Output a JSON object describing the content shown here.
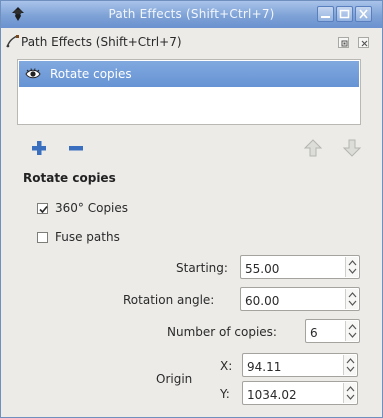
{
  "window": {
    "title": "Path Effects  (Shift+Ctrl+7)",
    "controls": {
      "minimize_icon": "minimize-icon",
      "maximize_icon": "maximize-icon",
      "close_icon": "close-icon"
    }
  },
  "dock": {
    "title": "Path Effects  (Shift+Ctrl+7)",
    "icon": "path-effects-icon",
    "iconify_icon": "iconify-icon",
    "close_icon": "close-icon"
  },
  "effects_list": {
    "items": [
      {
        "label": "Rotate copies",
        "visible": true,
        "icon": "eye-icon",
        "selected": true
      }
    ]
  },
  "list_toolbar": {
    "add_icon": "plus-icon",
    "remove_icon": "minus-icon",
    "move_up_icon": "arrow-up-icon",
    "move_down_icon": "arrow-down-icon"
  },
  "effect_params": {
    "section_title": "Rotate copies",
    "copies_360": {
      "label": "360° Copies",
      "checked": true
    },
    "fuse_paths": {
      "label": "Fuse paths",
      "checked": false
    },
    "starting": {
      "label": "Starting:",
      "value": "55.00"
    },
    "rotation_angle": {
      "label": "Rotation angle:",
      "value": "60.00"
    },
    "number_of_copies": {
      "label": "Number of copies:",
      "value": "6"
    },
    "origin": {
      "label": "Origin",
      "x": {
        "label": "X:",
        "value": "94.11"
      },
      "y": {
        "label": "Y:",
        "value": "1034.02"
      }
    }
  },
  "colors": {
    "titlebar": "#7ea2d6",
    "selection": "#6f9bd8",
    "add_blue": "#3a6fc0",
    "disabled_arrow": "#c8c8c4"
  }
}
